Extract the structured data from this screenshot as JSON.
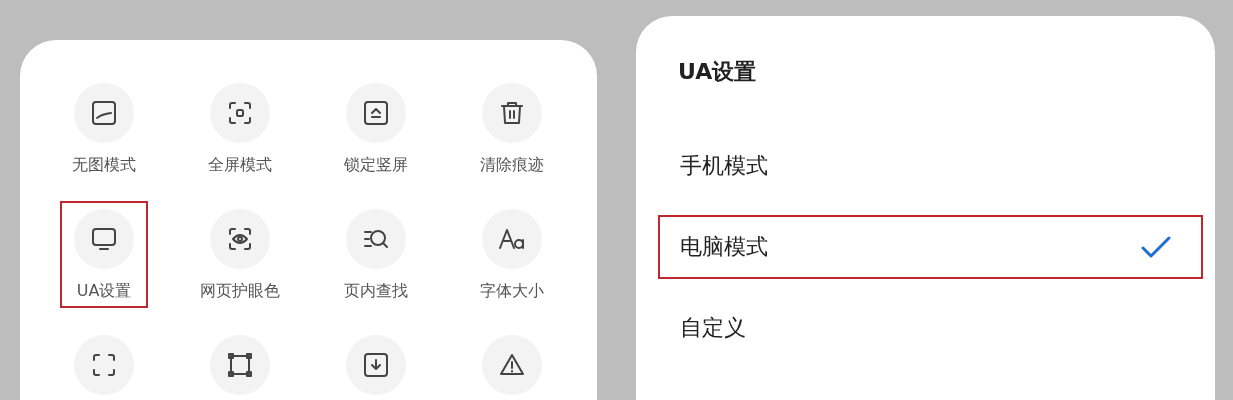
{
  "tools_panel": {
    "items": [
      {
        "label": "无图模式",
        "highlighted": false
      },
      {
        "label": "全屏模式",
        "highlighted": false
      },
      {
        "label": "锁定竖屏",
        "highlighted": false
      },
      {
        "label": "清除痕迹",
        "highlighted": false
      },
      {
        "label": "UA设置",
        "highlighted": true
      },
      {
        "label": "网页护眼色",
        "highlighted": false
      },
      {
        "label": "页内查找",
        "highlighted": false
      },
      {
        "label": "字体大小",
        "highlighted": false
      },
      {
        "highlighted": false
      },
      {
        "highlighted": false
      },
      {
        "highlighted": false
      },
      {
        "highlighted": false
      }
    ]
  },
  "ua_dialog": {
    "title": "UA设置",
    "options": [
      {
        "label": "手机模式",
        "selected": false,
        "highlighted": false
      },
      {
        "label": "电脑模式",
        "selected": true,
        "highlighted": true
      },
      {
        "label": "自定义",
        "selected": false,
        "highlighted": false
      }
    ]
  }
}
